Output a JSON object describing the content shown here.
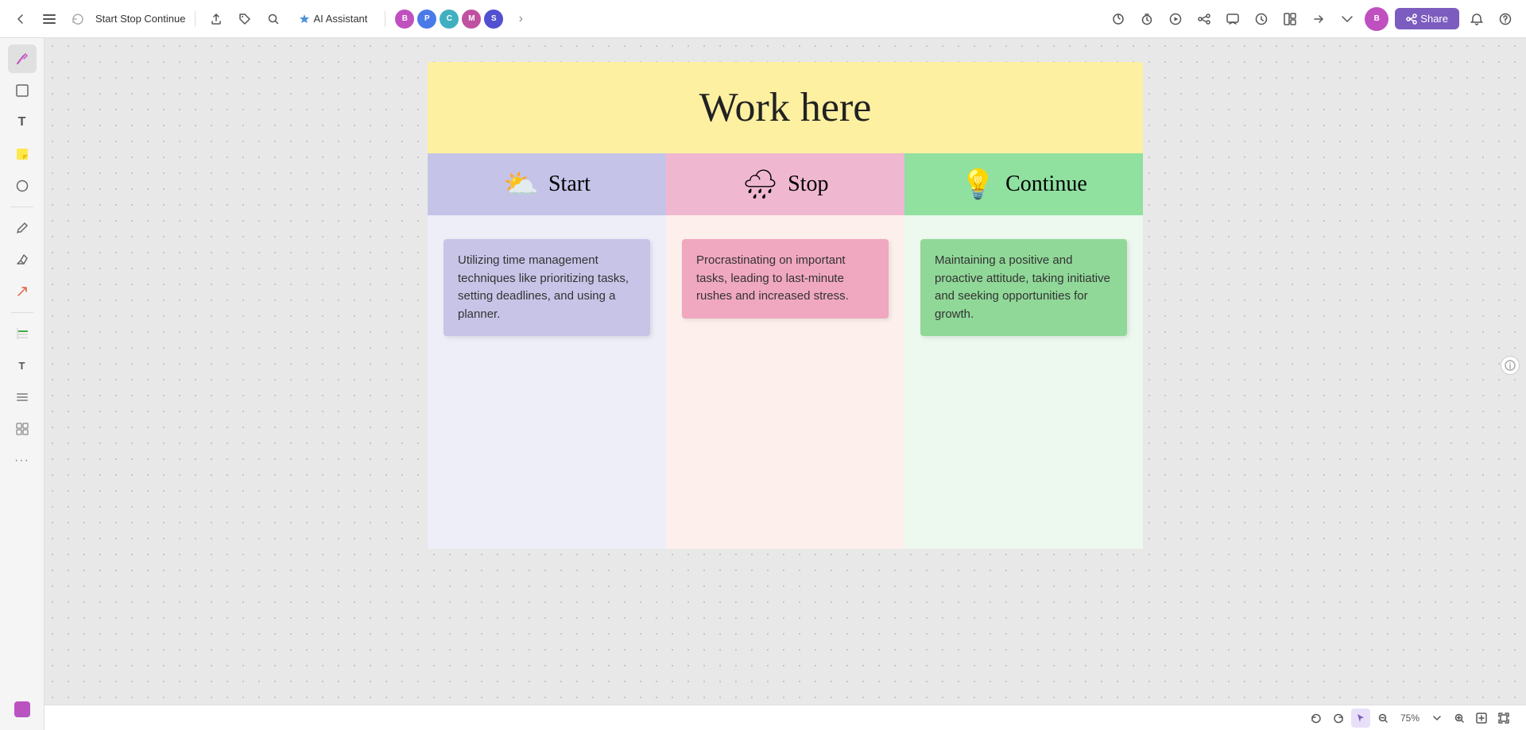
{
  "app": {
    "title": "Start Stop Continue"
  },
  "toolbar": {
    "back_label": "←",
    "menu_label": "≡",
    "sync_label": "⟳",
    "export_label": "↑",
    "tag_label": "🏷",
    "search_label": "🔍",
    "ai_assistant_label": "AI Assistant",
    "more_label": "›",
    "share_label": "Share",
    "notification_label": "🔔",
    "help_label": "?"
  },
  "sidebar": {
    "items": [
      {
        "name": "brush-icon",
        "label": "🎨"
      },
      {
        "name": "frame-icon",
        "label": "⬜"
      },
      {
        "name": "text-icon",
        "label": "T"
      },
      {
        "name": "sticky-icon",
        "label": "🟨"
      },
      {
        "name": "shape-icon",
        "label": "◯"
      },
      {
        "name": "pen-icon",
        "label": "✒"
      },
      {
        "name": "eraser-icon",
        "label": "✏"
      },
      {
        "name": "scissor-icon",
        "label": "✂"
      },
      {
        "name": "table-icon",
        "label": "▦"
      },
      {
        "name": "text2-icon",
        "label": "T"
      },
      {
        "name": "list-icon",
        "label": "☰"
      },
      {
        "name": "grid-icon",
        "label": "⊞"
      },
      {
        "name": "more-icon",
        "label": "···"
      },
      {
        "name": "theme-icon",
        "label": "🎭"
      }
    ]
  },
  "board": {
    "title": "Work here",
    "columns": [
      {
        "id": "start",
        "label": "Start",
        "emoji": "⛅",
        "header_bg": "#c5c3e8",
        "body_bg": "#eeeef8",
        "note_bg": "#c8c4e8",
        "note_text": "Utilizing time management techniques like prioritizing tasks, setting deadlines, and using a planner."
      },
      {
        "id": "stop",
        "label": "Stop",
        "emoji": "🌧",
        "header_bg": "#f0b8d0",
        "body_bg": "#fdf0ec",
        "note_bg": "#f0a8c0",
        "note_text": "Procrastinating on important tasks, leading to last-minute rushes and increased stress."
      },
      {
        "id": "continue",
        "label": "Continue",
        "emoji": "💡",
        "header_bg": "#90e0a0",
        "body_bg": "#edf8ee",
        "note_bg": "#90d898",
        "note_text": "Maintaining a positive and proactive attitude, taking initiative and seeking opportunities for growth."
      }
    ]
  },
  "bottom_bar": {
    "zoom_out_label": "−",
    "zoom_level": "75%",
    "zoom_in_label": "+",
    "fit_label": "⊡",
    "expand_label": "⤢"
  },
  "collab_avatars": [
    {
      "color": "#e05050",
      "initial": "B"
    },
    {
      "color": "#5090e0",
      "initial": "P"
    },
    {
      "color": "#50b0c0",
      "initial": "C"
    },
    {
      "color": "#c050a0",
      "initial": "M"
    },
    {
      "color": "#5050c0",
      "initial": "S"
    }
  ]
}
